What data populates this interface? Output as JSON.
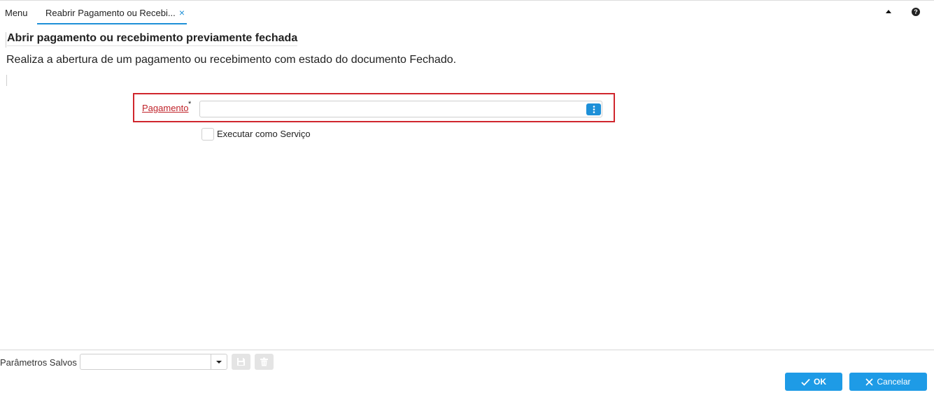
{
  "tabs": {
    "menu_label": "Menu",
    "active_label": "Reabrir Pagamento ou Recebi...",
    "close_glyph": "×"
  },
  "header": {
    "title": "Abrir pagamento ou recebimento previamente fechada",
    "description": "Realiza a abertura de um pagamento ou recebimento com estado do documento Fechado."
  },
  "form": {
    "pagamento": {
      "label": "Pagamento",
      "required_mark": "*",
      "value": "",
      "lookup_icon": "vertical-dots-icon"
    },
    "run_as_service": {
      "label": "Executar como Serviço",
      "checked": false
    }
  },
  "footer": {
    "saved_params_label": "Parâmetros Salvos",
    "saved_params_value": "",
    "ok_label": "OK",
    "cancel_label": "Cancelar"
  },
  "colors": {
    "accent": "#1e90d8",
    "button": "#1e9be6",
    "error": "#d0262d"
  }
}
